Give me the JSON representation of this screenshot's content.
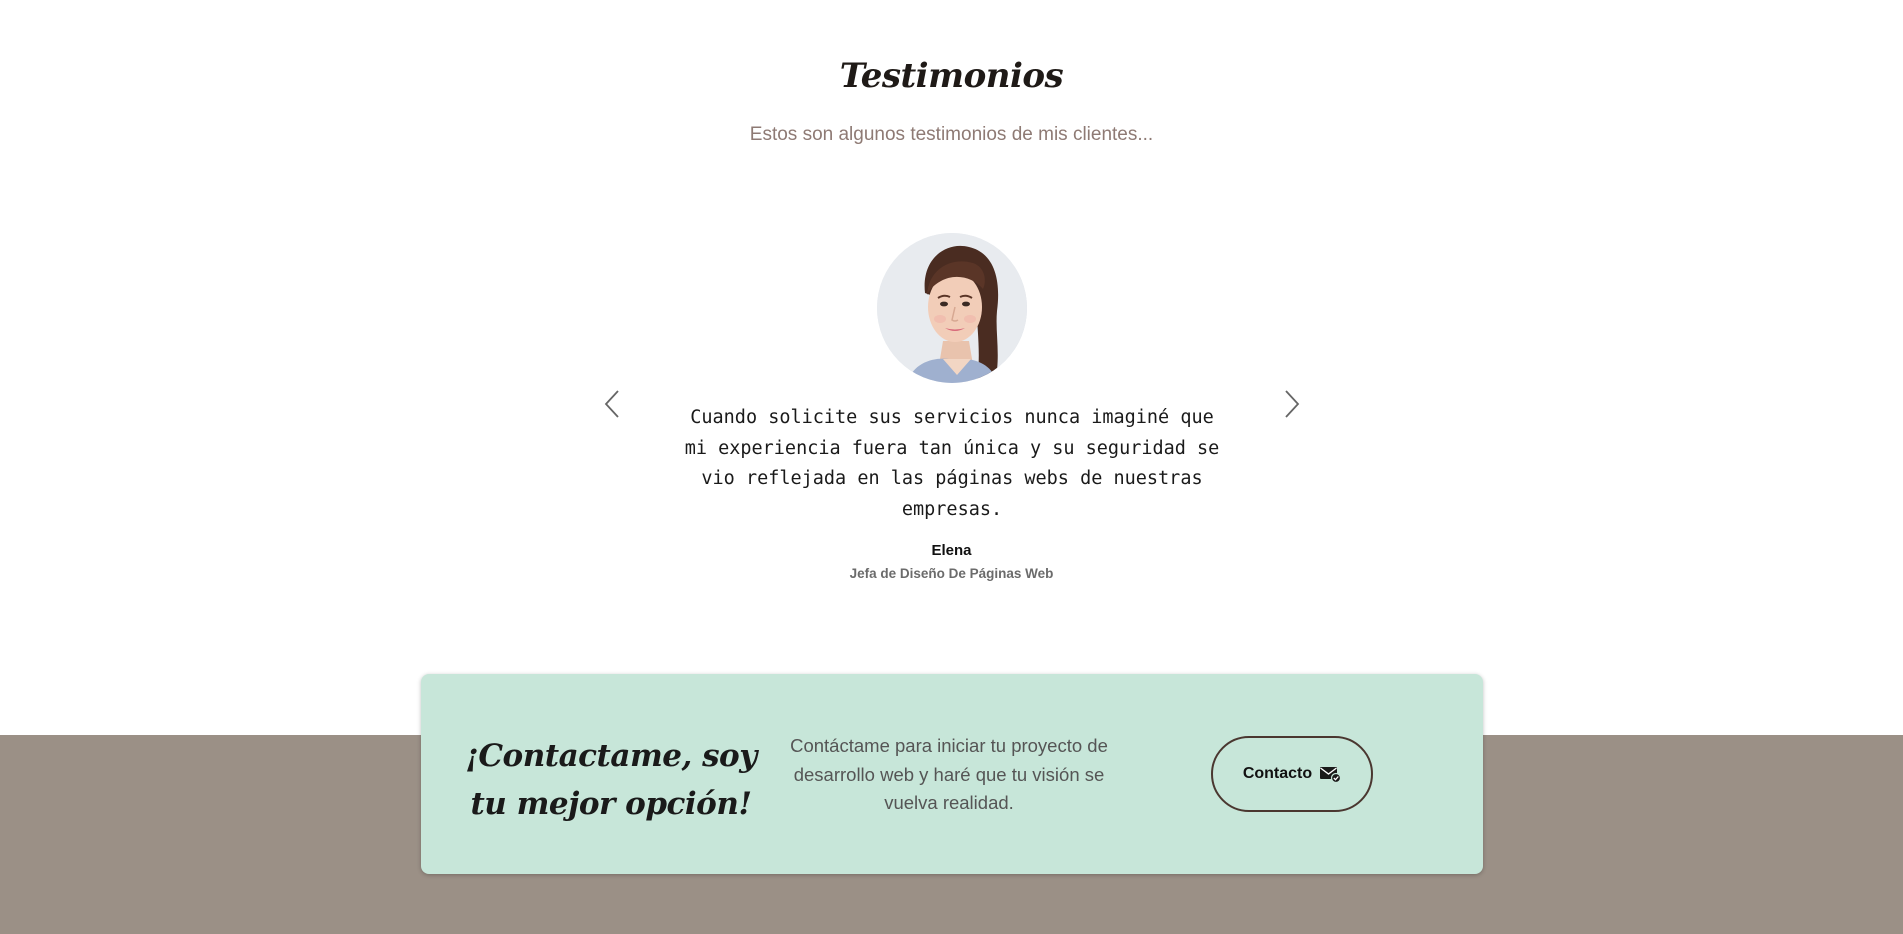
{
  "testimonials": {
    "title": "Testimonios",
    "subtitle": "Estos son algunos testimonios de mis clientes...",
    "current": {
      "quote": "Cuando solicite sus servicios nunca imaginé que mi experiencia fuera tan única y su seguridad se vio reflejada en las páginas webs de nuestras empresas.",
      "name": "Elena",
      "role": "Jefa de Diseño De Páginas Web",
      "avatar_icon": "woman-portrait-photo"
    },
    "prev_icon": "chevron-left-icon",
    "next_icon": "chevron-right-icon"
  },
  "cta": {
    "heading": "¡Contactame, soy tu mejor opción!",
    "text": "Contáctame para iniciar tu proyecto de desarrollo web y haré que tu visión se vuelva realidad.",
    "button_label": "Contacto",
    "button_icon": "mail-check-icon"
  },
  "colors": {
    "cta_background": "#c7e6d9",
    "footer_band": "#9b9086",
    "subtitle": "#8e7a74",
    "button_border": "#4a3730"
  }
}
